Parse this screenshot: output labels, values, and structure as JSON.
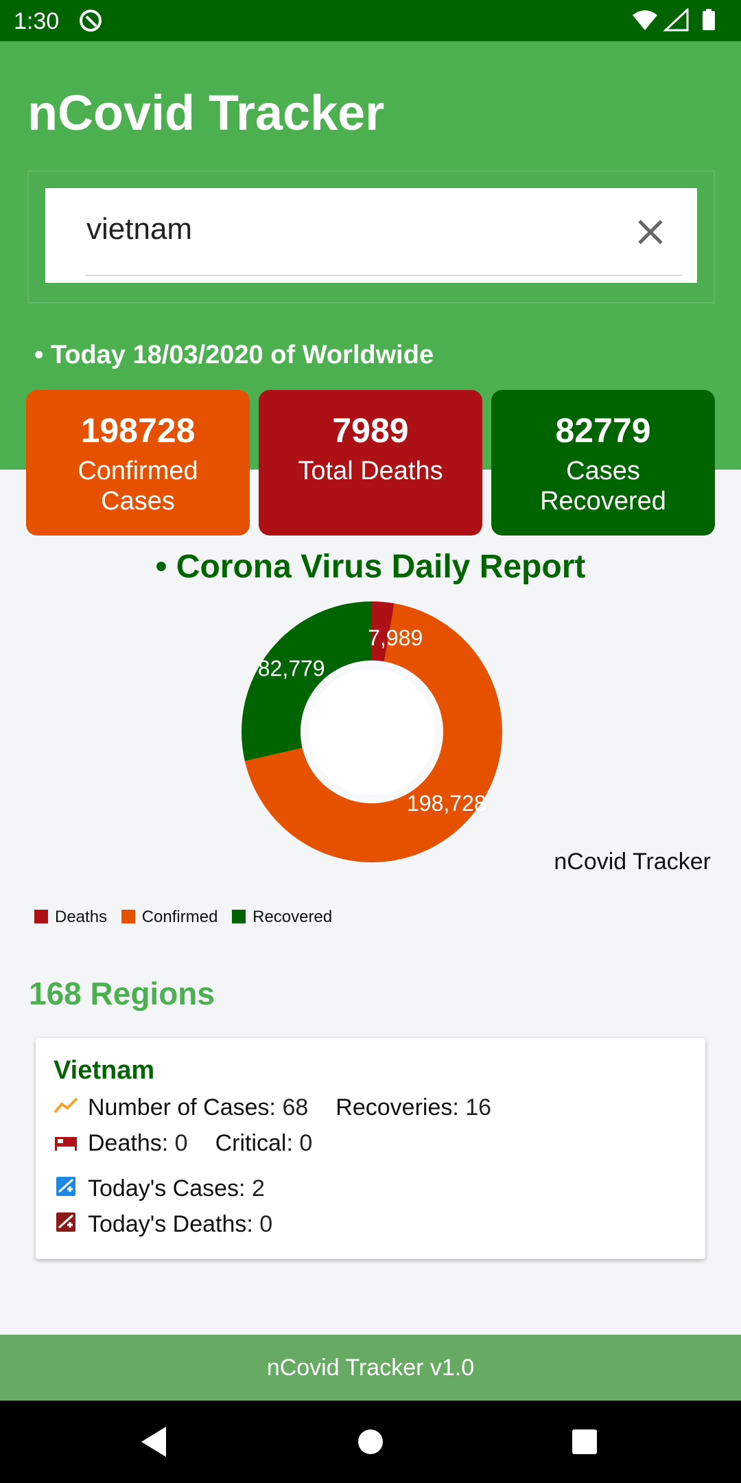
{
  "status_bar": {
    "time": "1:30"
  },
  "header": {
    "title": "nCovid Tracker",
    "search": {
      "value": "vietnam",
      "placeholder": ""
    },
    "today_label": "• Today 18/03/2020 of Worldwide"
  },
  "stats": [
    {
      "value": "198728",
      "label": "Confirmed Cases",
      "color": "#e65100"
    },
    {
      "value": "7989",
      "label": "Total Deaths",
      "color": "#ad1115"
    },
    {
      "value": "82779",
      "label": "Cases Recovered",
      "color": "#006400"
    }
  ],
  "report": {
    "title": "• Corona Virus Daily Report",
    "caption": "nCovid Tracker"
  },
  "chart_data": {
    "type": "pie",
    "categories": [
      "Deaths",
      "Confirmed",
      "Recovered"
    ],
    "values": [
      7989,
      198728,
      82779
    ],
    "data_labels": [
      "7,989",
      "198,728",
      "82,779"
    ],
    "colors": [
      "#ad1115",
      "#e65100",
      "#006400"
    ],
    "donut": true,
    "legend_position": "bottom-left"
  },
  "regions": {
    "title": "168 Regions",
    "items": [
      {
        "name": "Vietnam",
        "cases_label": "Number of Cases:",
        "cases_value": "68",
        "recoveries_label": "Recoveries:",
        "recoveries_value": "16",
        "deaths_label": "Deaths:",
        "deaths_value": "0",
        "critical_label": "Critical:",
        "critical_value": "0",
        "today_cases_label": "Today's Cases:",
        "today_cases_value": "2",
        "today_deaths_label": "Today's Deaths:",
        "today_deaths_value": "0"
      }
    ]
  },
  "footer": {
    "text": "nCovid Tracker v1.0"
  },
  "icons": {
    "status_left": "app-notification-icon",
    "status_right": [
      "wifi-icon",
      "signal-icon",
      "battery-icon"
    ],
    "clear": "close-icon",
    "cases": "trending-up-icon",
    "deaths": "bed-icon",
    "today_cases": "hospital-plus-icon",
    "today_deaths": "hospital-plus-icon"
  }
}
